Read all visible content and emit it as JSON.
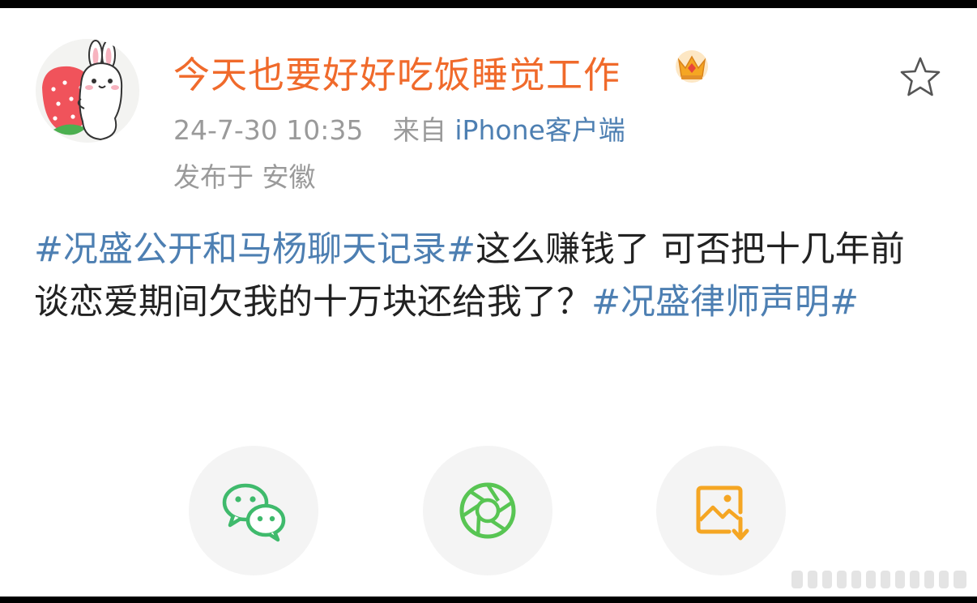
{
  "post": {
    "username": "今天也要好好吃饭睡觉工作",
    "timestamp": "24-7-30 10:35",
    "source_prefix": "来自",
    "source_client": "iPhone客户端",
    "location": "发布于 安徽",
    "content": {
      "tag1": "#况盛公开和马杨聊天记录#",
      "text": "这么赚钱了 可否把十几年前谈恋爱期间欠我的十万块还给我了？",
      "tag2": "#况盛律师声明#"
    }
  },
  "icons": {
    "avatar": "rabbit-strawberry-avatar",
    "badge": "crown-icon",
    "favorite": "star-icon",
    "share_wechat": "wechat-icon",
    "share_moments": "moments-icon",
    "save_image": "save-image-icon"
  },
  "colors": {
    "username": "#f06a2b",
    "link": "#4d7fb2",
    "meta": "#9a9a9a",
    "text": "#222222",
    "wechat_green": "#3fba6c",
    "moments_green": "#58c553",
    "save_orange": "#f5a623"
  }
}
